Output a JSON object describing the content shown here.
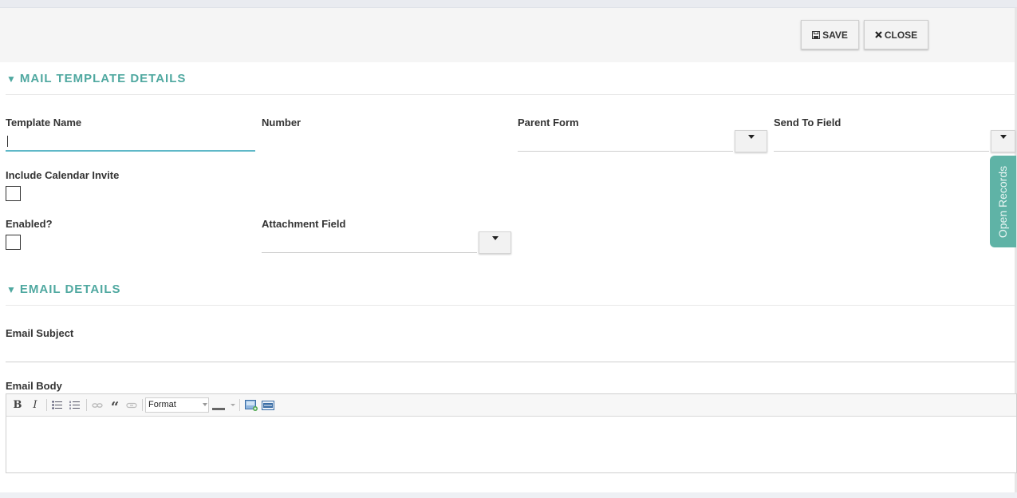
{
  "toolbar": {
    "save_label": "SAVE",
    "close_label": "CLOSE"
  },
  "sections": {
    "mail_template": {
      "title": "MAIL TEMPLATE DETAILS"
    },
    "email_details": {
      "title": "EMAIL DETAILS"
    }
  },
  "fields": {
    "template_name": {
      "label": "Template Name",
      "value": ""
    },
    "number": {
      "label": "Number",
      "value": ""
    },
    "parent_form": {
      "label": "Parent Form",
      "value": ""
    },
    "send_to_field": {
      "label": "Send To Field",
      "value": ""
    },
    "include_calendar_invite": {
      "label": "Include Calendar Invite",
      "checked": false
    },
    "enabled": {
      "label": "Enabled?",
      "checked": false
    },
    "attachment_field": {
      "label": "Attachment Field",
      "value": ""
    },
    "email_subject": {
      "label": "Email Subject",
      "value": ""
    },
    "email_body": {
      "label": "Email Body",
      "value": ""
    }
  },
  "editor_toolbar": {
    "format_label": "Format",
    "buttons": [
      "bold-icon",
      "italic-icon",
      "bulleted-list-icon",
      "numbered-list-icon",
      "unlink-icon",
      "blockquote-icon",
      "link-icon",
      "text-color-icon",
      "image-icon",
      "html-source-icon"
    ]
  },
  "side_tab": {
    "label": "Open Records"
  },
  "colors": {
    "accent": "#4fa8a0",
    "side_tab": "#5fb3a6",
    "focus": "#5fb8c8"
  }
}
